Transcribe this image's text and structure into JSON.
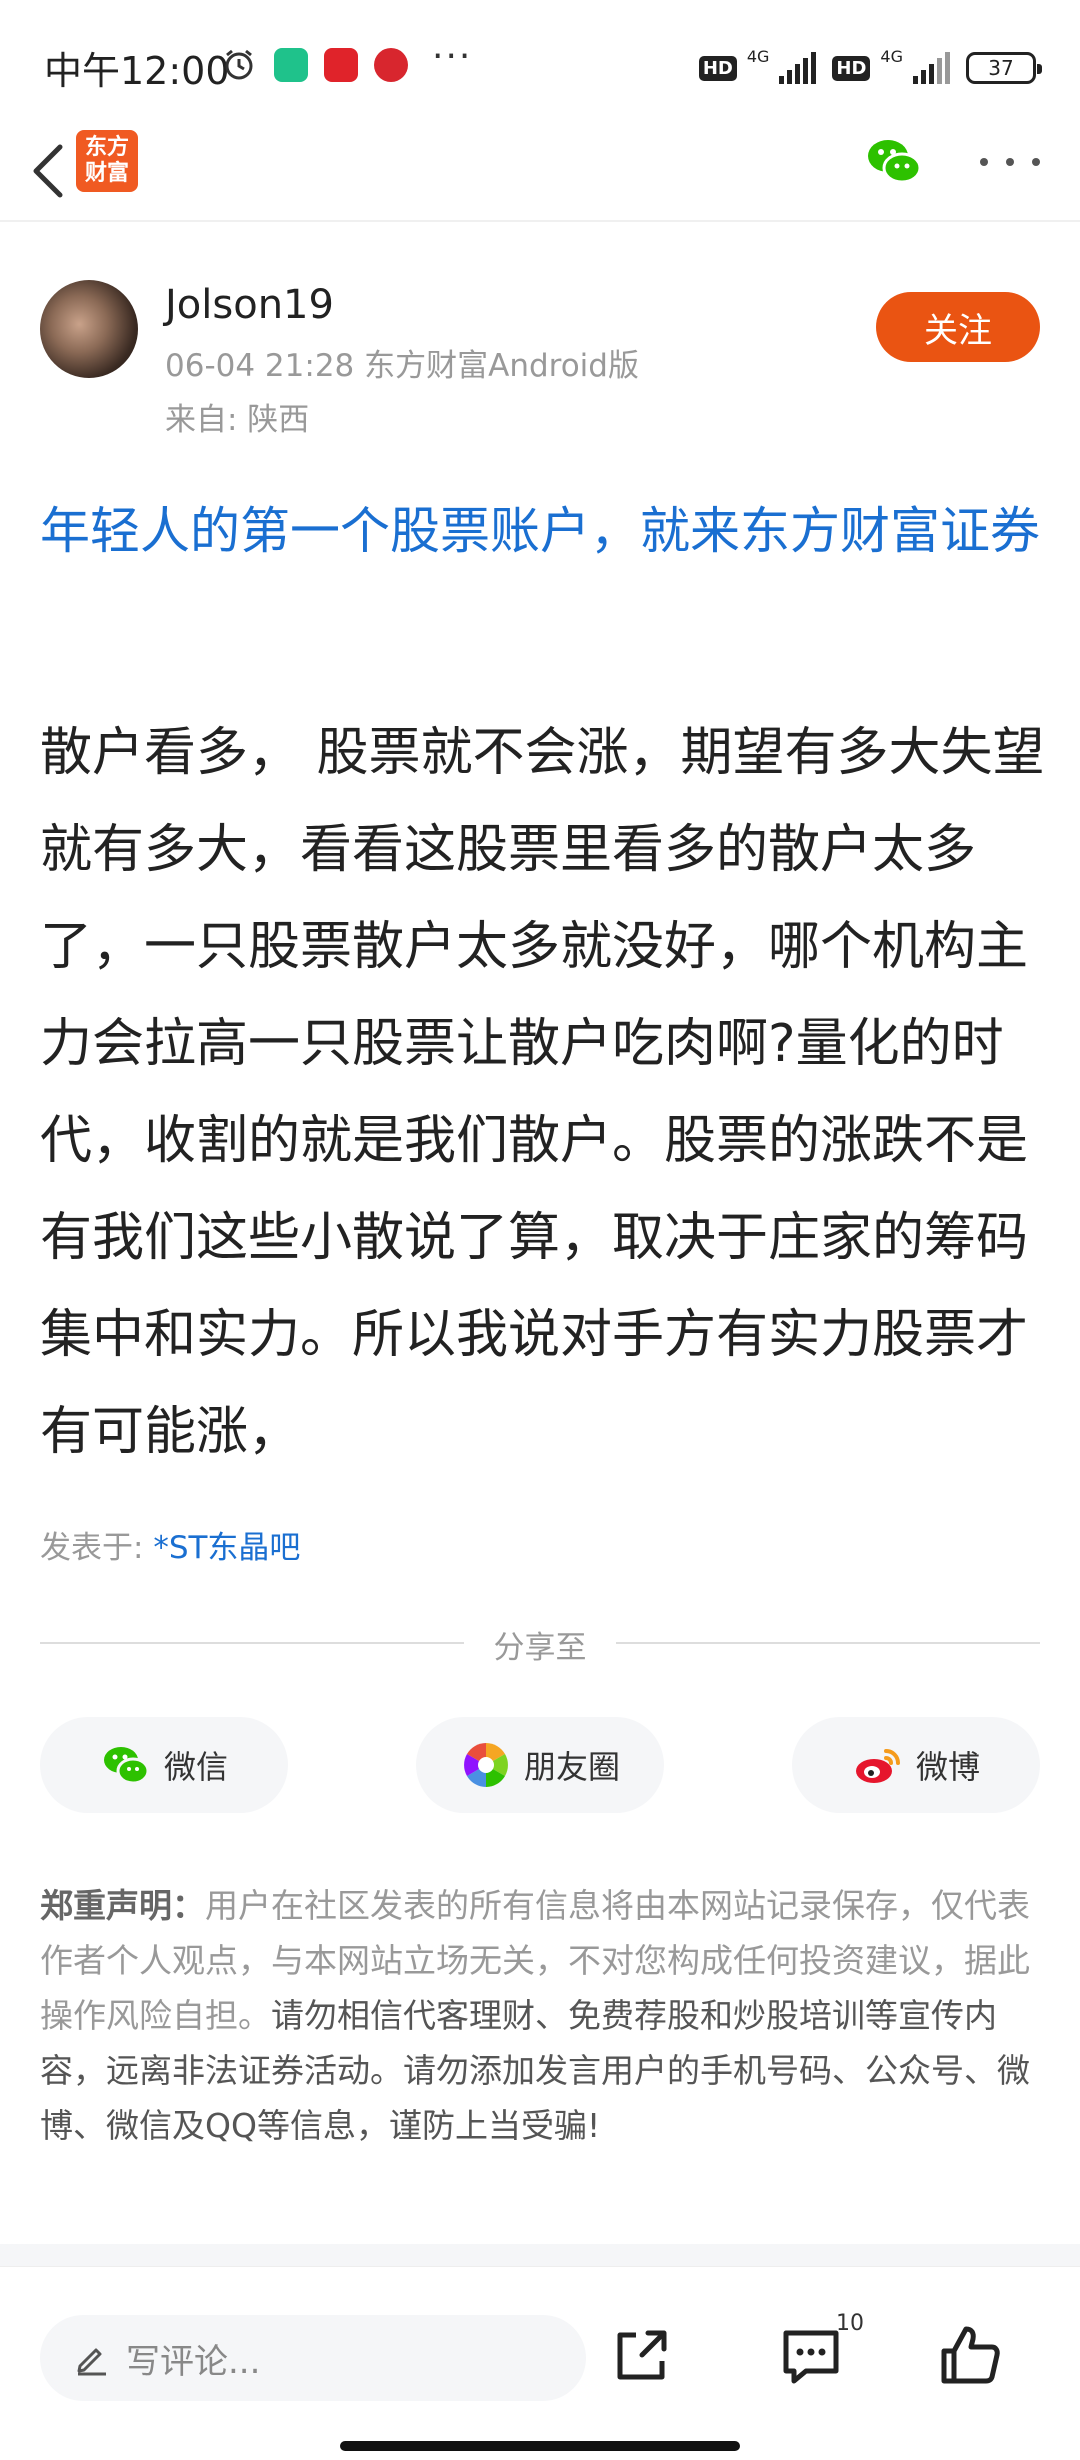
{
  "status_bar": {
    "time": "中午12:00",
    "more": "···",
    "hd": "HD",
    "network": "4G",
    "battery": "37"
  },
  "nav": {
    "logo_text": "东方财富"
  },
  "author": {
    "name": "Jolson19",
    "meta": "06-04 21:28 东方财富Android版",
    "location": "来自: 陕西",
    "follow_label": "关注"
  },
  "post": {
    "title": "年轻人的第一个股票账户，就来东方财富证券",
    "body": "散户看多， 股票就不会涨，期望有多大失望就有多大，看看这股票里看多的散户太多了，一只股票散户太多就没好，哪个机构主力会拉高一只股票让散户吃肉啊?量化的时代，收割的就是我们散户。股票的涨跌不是有我们这些小散说了算，取决于庄家的筹码集中和实力。所以我说对手方有实力股票才有可能涨，",
    "posted_in_label": "发表于:",
    "forum": "*ST东晶吧"
  },
  "share": {
    "label": "分享至",
    "wechat": "微信",
    "moments": "朋友圈",
    "weibo": "微博"
  },
  "disclaimer": {
    "head": "郑重声明：",
    "normal": "用户在社区发表的所有信息将由本网站记录保存，仅代表作者个人观点，与本网站立场无关，不对您构成任何投资建议，据此操作风险自担。",
    "warning": "请勿相信代客理财、免费荐股和炒股培训等宣传内容，远离非法证券活动。请勿添加发言用户的手机号码、公众号、微博、微信及QQ等信息，谨防上当受骗!"
  },
  "bottom": {
    "comment_placeholder": "写评论...",
    "comment_count": "10"
  },
  "colors": {
    "accent_orange": "#ea5412",
    "link_blue": "#1a6fd1",
    "wechat_green": "#2dc100"
  }
}
